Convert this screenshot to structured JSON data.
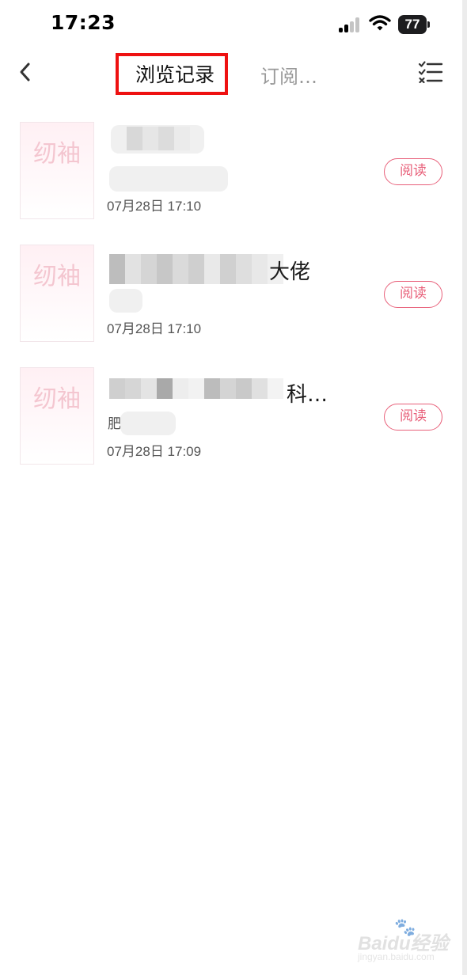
{
  "status_bar": {
    "time": "17:23",
    "battery": "77",
    "icons": [
      "signal-icon",
      "wifi-icon",
      "battery-icon"
    ]
  },
  "nav": {
    "back_icon": "chevron-left-icon",
    "tabs": [
      {
        "label": "浏览记录",
        "active": true,
        "highlighted": true
      },
      {
        "label": "订阅…",
        "active": false
      }
    ],
    "menu_icon": "checklist-menu-icon"
  },
  "history": [
    {
      "cover_logo": "纫袖",
      "title": "",
      "subtitle": "",
      "time": "07月28日 17:10",
      "action": "阅读"
    },
    {
      "cover_logo": "纫袖",
      "title": "大佬",
      "subtitle": "",
      "time": "07月28日 17:10",
      "action": "阅读"
    },
    {
      "cover_logo": "纫袖",
      "title": "科…",
      "subtitle": "肥",
      "time": "07月28日 17:09",
      "action": "阅读"
    }
  ],
  "watermark": {
    "brand": "Baidu经验",
    "url": "jingyan.baidu.com"
  },
  "colors": {
    "accent": "#e8607a",
    "highlight_box": "#ee1111",
    "cover_logo": "#f4c6d0"
  }
}
